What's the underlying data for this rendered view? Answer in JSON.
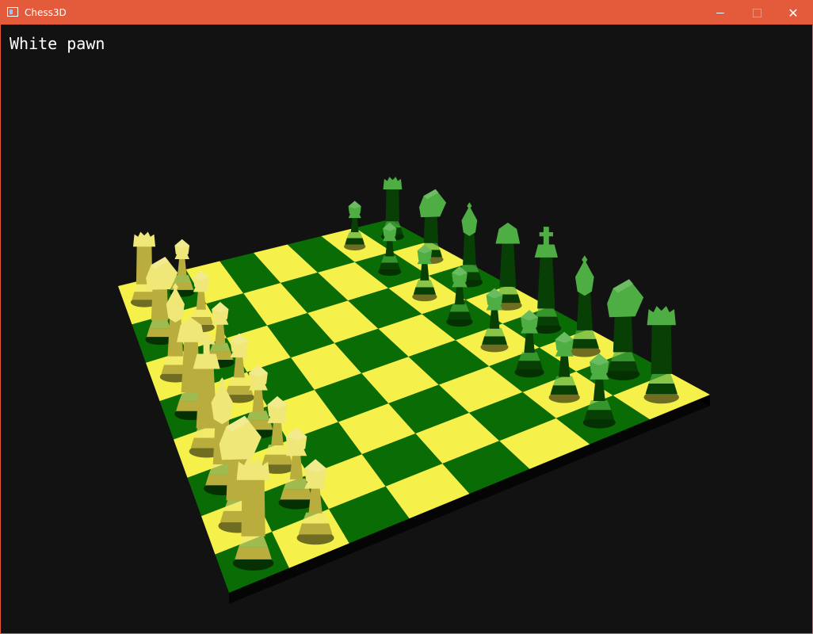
{
  "window": {
    "title": "Chess3D",
    "minimize_label": "minimize",
    "maximize_label": "maximize",
    "close_label": "close"
  },
  "status": {
    "selected_piece": "White pawn"
  },
  "board": {
    "files": 8,
    "ranks": 8,
    "light_square_color": "#f6f14a",
    "dark_square_color": "#0a6c05",
    "edge_color": "#050505"
  },
  "pieces": {
    "white_color": "#b9ad3e",
    "white_highlight": "#f0e779",
    "black_color": "#073f05",
    "black_highlight": "#4fae43",
    "white": [
      {
        "name": "white-rook",
        "kind": "rook"
      },
      {
        "name": "white-knight",
        "kind": "knight"
      },
      {
        "name": "white-bishop",
        "kind": "bishop"
      },
      {
        "name": "white-queen",
        "kind": "queen"
      },
      {
        "name": "white-king",
        "kind": "king"
      },
      {
        "name": "white-bishop",
        "kind": "bishop"
      },
      {
        "name": "white-knight",
        "kind": "knight"
      },
      {
        "name": "white-rook",
        "kind": "rook"
      },
      {
        "name": "white-pawn",
        "kind": "pawn"
      },
      {
        "name": "white-pawn",
        "kind": "pawn"
      },
      {
        "name": "white-pawn",
        "kind": "pawn"
      },
      {
        "name": "white-pawn",
        "kind": "pawn"
      },
      {
        "name": "white-pawn",
        "kind": "pawn"
      },
      {
        "name": "white-pawn",
        "kind": "pawn"
      },
      {
        "name": "white-pawn",
        "kind": "pawn"
      },
      {
        "name": "white-pawn",
        "kind": "pawn"
      }
    ],
    "black": [
      {
        "name": "black-rook",
        "kind": "rook"
      },
      {
        "name": "black-knight",
        "kind": "knight"
      },
      {
        "name": "black-bishop",
        "kind": "bishop"
      },
      {
        "name": "black-queen",
        "kind": "queen"
      },
      {
        "name": "black-king",
        "kind": "king"
      },
      {
        "name": "black-bishop",
        "kind": "bishop"
      },
      {
        "name": "black-knight",
        "kind": "knight"
      },
      {
        "name": "black-rook",
        "kind": "rook"
      },
      {
        "name": "black-pawn",
        "kind": "pawn"
      },
      {
        "name": "black-pawn",
        "kind": "pawn"
      },
      {
        "name": "black-pawn",
        "kind": "pawn"
      },
      {
        "name": "black-pawn",
        "kind": "pawn"
      },
      {
        "name": "black-pawn",
        "kind": "pawn"
      },
      {
        "name": "black-pawn",
        "kind": "pawn"
      },
      {
        "name": "black-pawn",
        "kind": "pawn"
      },
      {
        "name": "black-pawn",
        "kind": "pawn"
      }
    ]
  }
}
